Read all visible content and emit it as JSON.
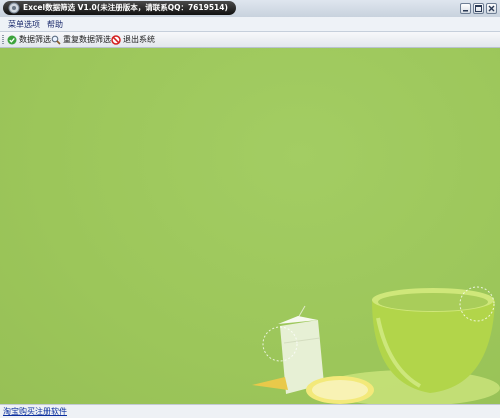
{
  "window": {
    "title": "Excel数据筛选 V1.0(未注册版本，请联系QQ：7619514)"
  },
  "menu": {
    "items": [
      "菜单选项",
      "帮助"
    ]
  },
  "toolbar": {
    "filter_label": "数据筛选",
    "dedupe_label": "重复数据筛选",
    "exit_label": "退出系统"
  },
  "status": {
    "register_link": "淘宝购买注册软件"
  },
  "colors": {
    "background_green": "#9ec85c",
    "cup_green": "#b7d94a",
    "link_blue": "#0b2f9e"
  }
}
